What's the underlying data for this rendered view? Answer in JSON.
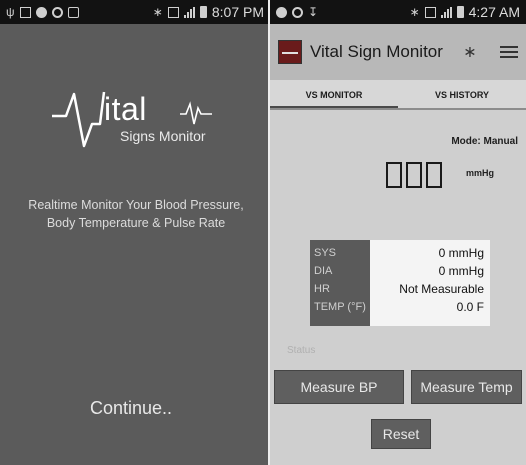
{
  "left": {
    "status_time": "8:07 PM",
    "logo_text": "ital",
    "logo_subtitle": "Signs Monitor",
    "tagline_line1": "Realtime Monitor Your Blood Pressure,",
    "tagline_line2": "Body Temperature & Pulse Rate",
    "continue_label": "Continue.."
  },
  "right": {
    "status_time": "4:27 AM",
    "app_title": "Vital Sign Monitor",
    "tabs": [
      {
        "label": "VS MONITOR",
        "active": true
      },
      {
        "label": "VS HISTORY",
        "active": false
      }
    ],
    "mode": "Mode: Manual",
    "unit": "mmHg",
    "vitals": {
      "labels": [
        "SYS",
        "DIA",
        "HR",
        "TEMP (°F)"
      ],
      "values": [
        "0 mmHg",
        "0 mmHg",
        "Not Measurable",
        "0.0 F"
      ]
    },
    "status_label": "Status",
    "buttons": {
      "measure_bp": "Measure BP",
      "measure_temp": "Measure Temp",
      "reset": "Reset"
    }
  },
  "icons": {
    "status_left": [
      "usb-icon",
      "image-icon",
      "record-icon",
      "power-icon",
      "android-icon"
    ],
    "status_right": [
      "bluetooth-icon",
      "data-icon",
      "signal-icon",
      "battery-icon"
    ]
  },
  "colors": {
    "splash_bg": "#5b5b5b",
    "app_bg": "#cfcfcf",
    "actionbar_bg": "#b8b8b8",
    "button_bg": "#5f5f5f"
  }
}
